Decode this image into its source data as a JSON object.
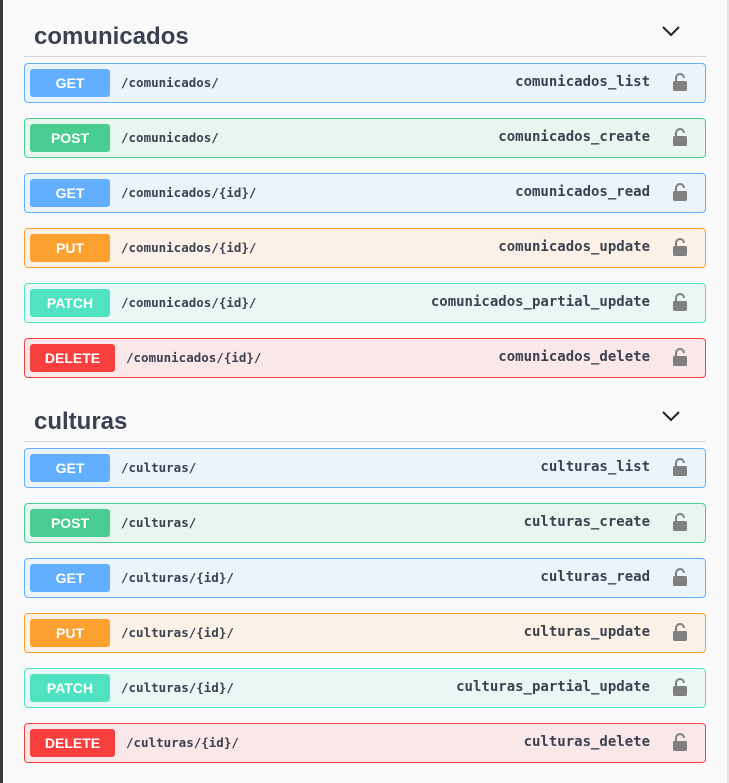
{
  "sections": [
    {
      "title": "comunicados",
      "operations": [
        {
          "method": "GET",
          "path": "/comunicados/",
          "operation_id": "comunicados_list"
        },
        {
          "method": "POST",
          "path": "/comunicados/",
          "operation_id": "comunicados_create"
        },
        {
          "method": "GET",
          "path": "/comunicados/{id}/",
          "operation_id": "comunicados_read"
        },
        {
          "method": "PUT",
          "path": "/comunicados/{id}/",
          "operation_id": "comunicados_update"
        },
        {
          "method": "PATCH",
          "path": "/comunicados/{id}/",
          "operation_id": "comunicados_partial_update"
        },
        {
          "method": "DELETE",
          "path": "/comunicados/{id}/",
          "operation_id": "comunicados_delete"
        }
      ]
    },
    {
      "title": "culturas",
      "operations": [
        {
          "method": "GET",
          "path": "/culturas/",
          "operation_id": "culturas_list"
        },
        {
          "method": "POST",
          "path": "/culturas/",
          "operation_id": "culturas_create"
        },
        {
          "method": "GET",
          "path": "/culturas/{id}/",
          "operation_id": "culturas_read"
        },
        {
          "method": "PUT",
          "path": "/culturas/{id}/",
          "operation_id": "culturas_update"
        },
        {
          "method": "PATCH",
          "path": "/culturas/{id}/",
          "operation_id": "culturas_partial_update"
        },
        {
          "method": "DELETE",
          "path": "/culturas/{id}/",
          "operation_id": "culturas_delete"
        }
      ]
    }
  ],
  "icons": {
    "collapse": "chevron-down-icon",
    "auth": "lock-icon"
  },
  "colors": {
    "GET": "#61affe",
    "POST": "#49cc90",
    "PUT": "#fca130",
    "PATCH": "#50e3c2",
    "DELETE": "#f93e3e",
    "text": "#3b4151"
  }
}
